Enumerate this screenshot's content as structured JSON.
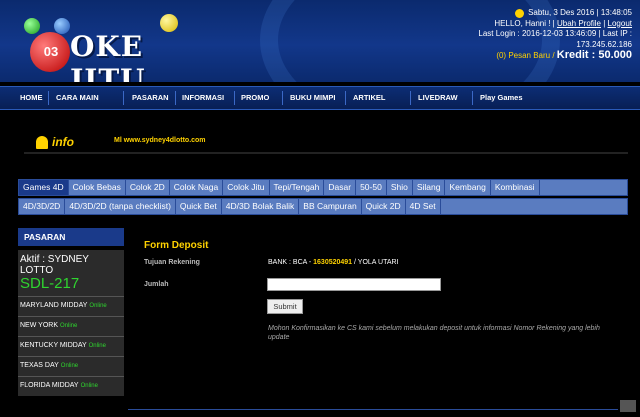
{
  "brand": {
    "number": "03",
    "name": "OKE JITU"
  },
  "user_info": {
    "date": "Sabtu, 3 Des 2016 | 13:48:05",
    "greeting": "HELLO, Hanni !",
    "change_profile": "Ubah Profile",
    "logout": "Logout",
    "last_login": "Last Login : 2016-12-03 13:46:09 | Last IP :",
    "last_ip": "173.245.62.186",
    "messages": "(0) Pesan Baru /",
    "credit": "Kredit : 50.000"
  },
  "nav": [
    "HOME",
    "CARA MAIN",
    "PASARAN",
    "INFORMASI",
    "PROMO",
    "BUKU MIMPI",
    "ARTIKEL",
    "LIVEDRAW",
    "Play Games"
  ],
  "info": {
    "label": "info",
    "ticker": "Ml www.sydney4dlotto.com"
  },
  "game_tabs": [
    "Games 4D",
    "Colok Bebas",
    "Colok 2D",
    "Colok Naga",
    "Colok Jitu",
    "Tepi/Tengah",
    "Dasar",
    "50-50",
    "Shio",
    "Silang",
    "Kembang",
    "Kombinasi"
  ],
  "sub_tabs": [
    "4D/3D/2D",
    "4D/3D/2D (tanpa checklist)",
    "Quick Bet",
    "4D/3D Bolak Balik",
    "BB Campuran",
    "Quick 2D",
    "4D Set"
  ],
  "sidebar": {
    "title": "PASARAN",
    "active_label": "Aktif : SYDNEY LOTTO",
    "active_code": "SDL-217",
    "online_label": "Online",
    "markets": [
      "MARYLAND MIDDAY",
      "NEW YORK",
      "KENTUCKY MIDDAY",
      "TEXAS DAY",
      "FLORIDA MIDDAY"
    ]
  },
  "form": {
    "title": "Form Deposit",
    "tujuan_label": "Tujuan Rekening",
    "bank_prefix": "BANK : BCA -",
    "account_number": "1630520491",
    "account_name": "/ YOLA UTARI",
    "jumlah_label": "Jumlah",
    "amount_value": "",
    "submit_label": "Submit",
    "note": "Mohon Konfirmasikan ke CS kami sebelum melakukan deposit untuk informasi Nomor Rekening yang lebih update"
  },
  "colors": {
    "header_bg": "#12378a",
    "accent_yellow": "#ffd200",
    "online_green": "#2fd52f",
    "tab_bg": "#5a7cc0"
  }
}
